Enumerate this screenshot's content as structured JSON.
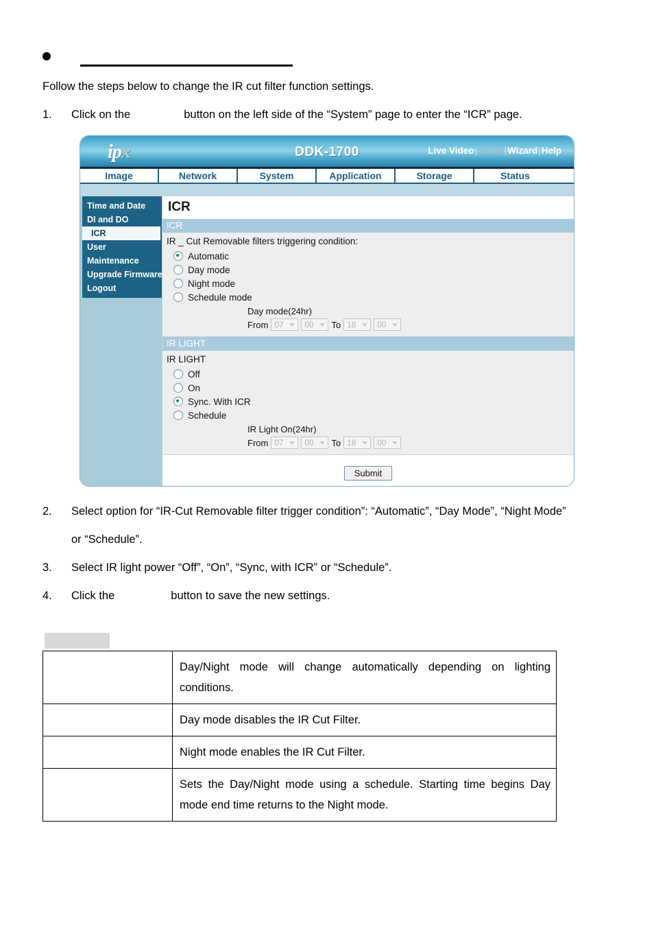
{
  "document": {
    "heading": "",
    "intro": "Follow the steps below to change the IR cut filter function settings.",
    "steps": [
      {
        "num": "1.",
        "before": "Click on the",
        "after": "button on the left side of the “System” page to enter the “ICR” page."
      },
      {
        "num": "2.",
        "line1": "Select option for “IR-Cut Removable filter trigger condition”: “Automatic”, “Day Mode”, “Night Mode”",
        "line2": "or “Schedule”."
      },
      {
        "num": "3.",
        "line1": "Select IR light power “Off”, “On”, “Sync, with ICR” or “Schedule”."
      },
      {
        "num": "4.",
        "before": "Click the",
        "after": "button to save the new settings."
      }
    ]
  },
  "screenshot": {
    "header": {
      "logo_i": "ip",
      "logo_x": "x",
      "model": "DDK-1700",
      "links": [
        {
          "label": "Live Video",
          "dim": false
        },
        {
          "label": "Setup",
          "dim": true
        },
        {
          "label": "Wizard",
          "dim": false
        },
        {
          "label": "Help",
          "dim": false
        }
      ],
      "separator": "|"
    },
    "tabs": [
      {
        "label": "Image"
      },
      {
        "label": "Network"
      },
      {
        "label": "System"
      },
      {
        "label": "Application"
      },
      {
        "label": "Storage"
      },
      {
        "label": "Status"
      }
    ],
    "sidebar": {
      "items": [
        {
          "label": "Time and Date",
          "active": false
        },
        {
          "label": "DI and DO",
          "active": false
        },
        {
          "label": "ICR",
          "active": true
        },
        {
          "label": "User",
          "active": false
        },
        {
          "label": "Maintenance",
          "active": false
        },
        {
          "label": "Upgrade Firmware",
          "active": false
        },
        {
          "label": "Logout",
          "active": false
        }
      ]
    },
    "main": {
      "page_title": "ICR",
      "icr_section": {
        "bar_label": "ICR",
        "condition_label": "IR _ Cut Removable filters triggering condition:",
        "options": [
          {
            "label": "Automatic",
            "selected": true
          },
          {
            "label": "Day mode",
            "selected": false
          },
          {
            "label": "Night mode",
            "selected": false
          },
          {
            "label": "Schedule mode",
            "selected": false
          }
        ],
        "schedule": {
          "caption": "Day mode(24hr)",
          "from_label": "From",
          "to_label": "To",
          "from_hour": "07",
          "from_min": "00",
          "to_hour": "18",
          "to_min": "00"
        }
      },
      "ir_light_section": {
        "bar_label": "IR LIGHT",
        "group_label": "IR LIGHT",
        "options": [
          {
            "label": "Off",
            "selected": false
          },
          {
            "label": "On",
            "selected": false
          },
          {
            "label": "Sync. With ICR",
            "selected": true
          },
          {
            "label": "Schedule",
            "selected": false
          }
        ],
        "schedule": {
          "caption": "IR Light On(24hr)",
          "from_label": "From",
          "to_label": "To",
          "from_hour": "07",
          "from_min": "00",
          "to_hour": "18",
          "to_min": "00"
        }
      },
      "submit_label": "Submit"
    },
    "colors": {
      "header_gradient_top": "#3f9cc4",
      "header_gradient_mid": "#8fd3e8",
      "sidebar_menu": "#1d6385",
      "sidebar_panel": "#a8cdd9",
      "section_bar": "#a8cade",
      "tab_text": "#1a5f86",
      "radio_dot": "#0a8a3a"
    }
  },
  "description_table": {
    "rows": [
      {
        "term": "",
        "description": "Day/Night mode will change automatically depending on lighting conditions."
      },
      {
        "term": "",
        "description": "Day mode disables the IR Cut Filter."
      },
      {
        "term": "",
        "description": "Night mode enables the IR Cut Filter."
      },
      {
        "term": "",
        "description": "Sets the Day/Night mode using a schedule. Starting time begins Day mode end time returns to the Night mode."
      }
    ]
  }
}
